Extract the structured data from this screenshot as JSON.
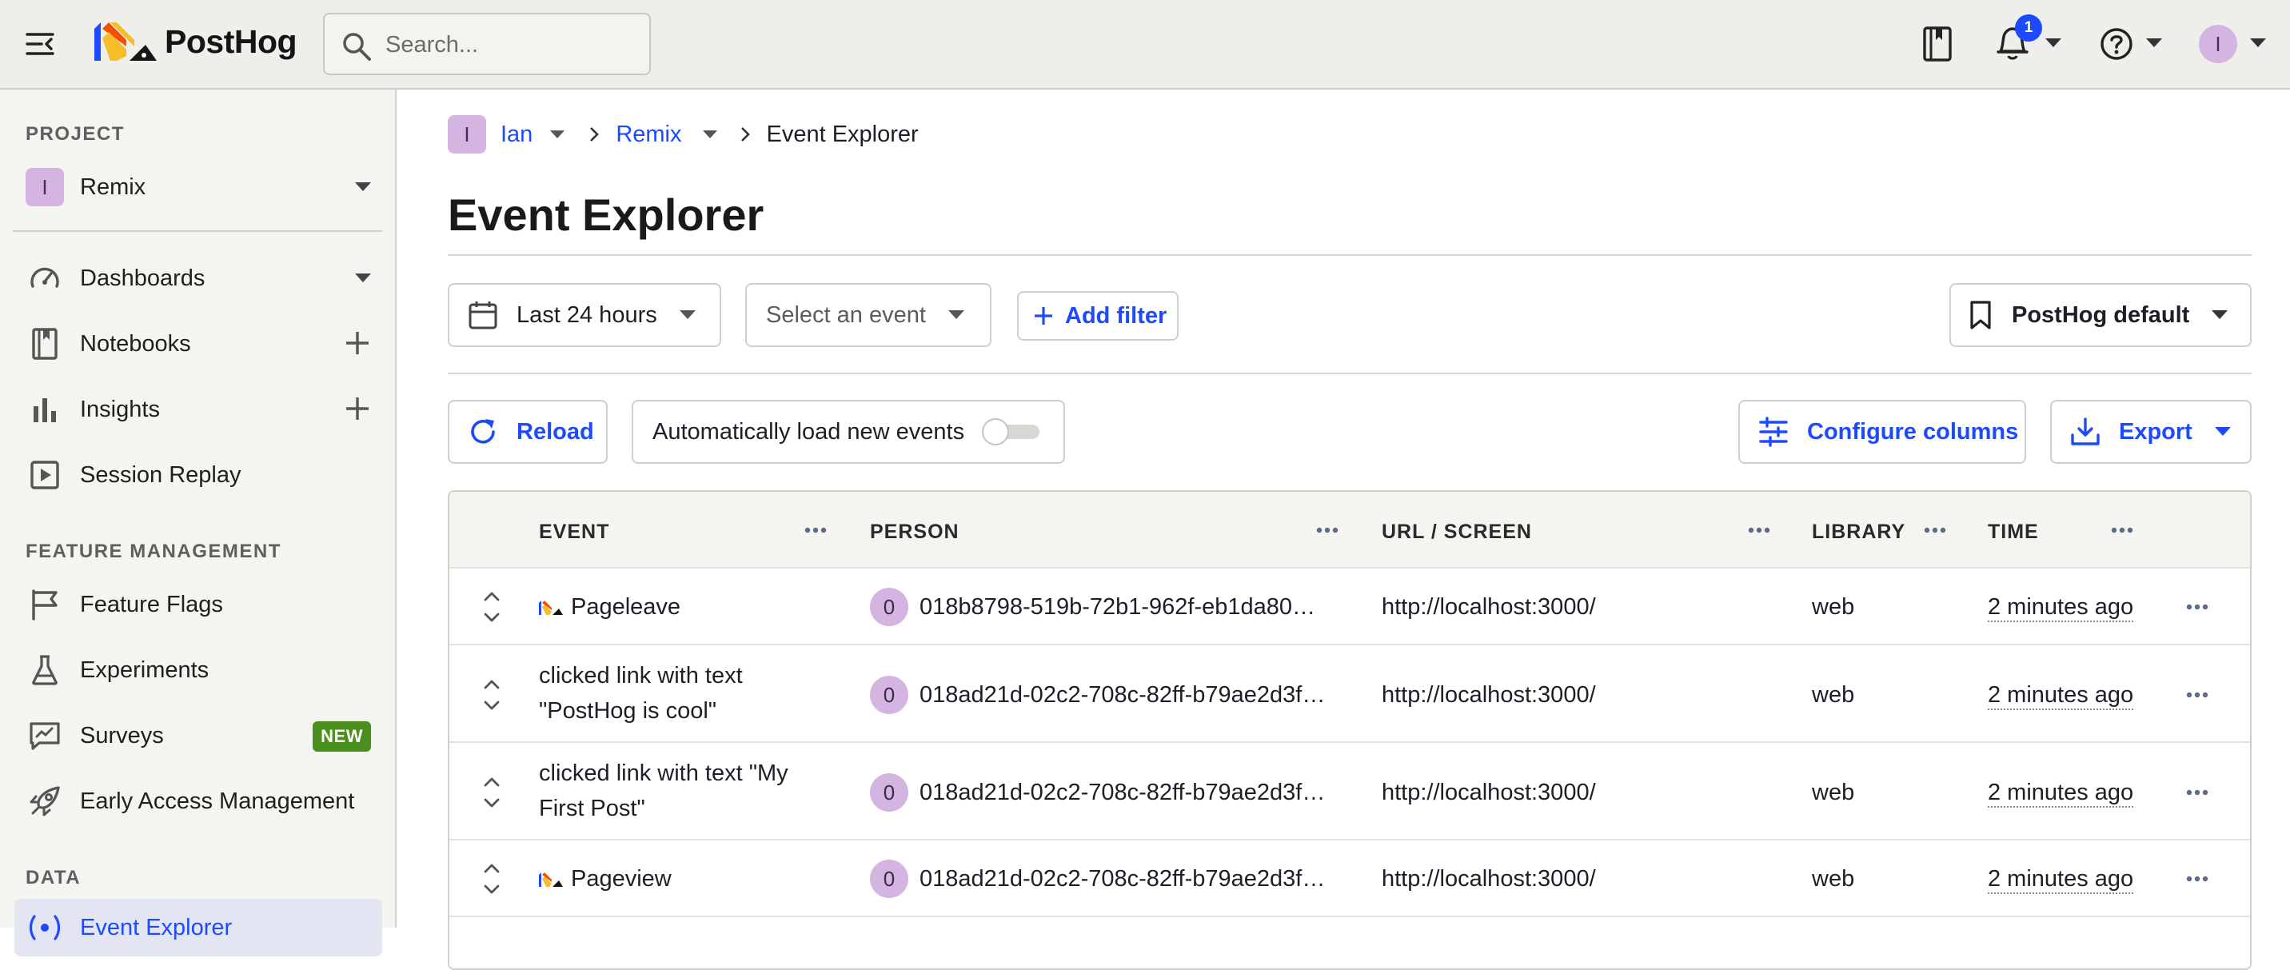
{
  "topbar": {
    "brand": "PostHog",
    "search_placeholder": "Search...",
    "notifications_count": "1",
    "user_initial": "I"
  },
  "sidebar": {
    "project_heading": "PROJECT",
    "project_initial": "I",
    "project_name": "Remix",
    "nav_items": [
      {
        "label": "Dashboards",
        "icon": "dashboard-icon"
      },
      {
        "label": "Notebooks",
        "icon": "notebook-icon"
      },
      {
        "label": "Insights",
        "icon": "insights-icon"
      },
      {
        "label": "Session Replay",
        "icon": "session-replay-icon"
      }
    ],
    "feature_heading": "FEATURE MANAGEMENT",
    "feature_items": [
      {
        "label": "Feature Flags",
        "icon": "flag-icon"
      },
      {
        "label": "Experiments",
        "icon": "flask-icon"
      },
      {
        "label": "Surveys",
        "icon": "survey-icon",
        "badge": "NEW"
      },
      {
        "label": "Early Access Management",
        "icon": "rocket-icon"
      }
    ],
    "data_heading": "DATA",
    "data_items": [
      {
        "label": "Event Explorer",
        "icon": "event-explorer-icon"
      }
    ]
  },
  "breadcrumb": {
    "org_initial": "I",
    "org": "Ian",
    "project": "Remix",
    "page": "Event Explorer"
  },
  "page": {
    "title": "Event Explorer"
  },
  "filters": {
    "date_range": "Last 24 hours",
    "event_placeholder": "Select an event",
    "add_filter": "Add filter",
    "columns_preset": "PostHog default"
  },
  "toolbar": {
    "reload": "Reload",
    "auto_load": "Automatically load new events",
    "auto_load_on": false,
    "configure_columns": "Configure columns",
    "export": "Export"
  },
  "table": {
    "columns": [
      "EVENT",
      "PERSON",
      "URL / SCREEN",
      "LIBRARY",
      "TIME"
    ],
    "rows": [
      {
        "event_line1": "Pageleave",
        "event_line2": "",
        "has_logo": true,
        "person_initial": "0",
        "person": "018b8798-519b-72b1-962f-eb1da80…",
        "url": "http://localhost:3000/",
        "library": "web",
        "time": "2 minutes ago"
      },
      {
        "event_line1": "clicked link with text",
        "event_line2": "\"PostHog is cool\"",
        "has_logo": false,
        "person_initial": "0",
        "person": "018ad21d-02c2-708c-82ff-b79ae2d3f…",
        "url": "http://localhost:3000/",
        "library": "web",
        "time": "2 minutes ago"
      },
      {
        "event_line1": "clicked link with text \"My",
        "event_line2": "First Post\"",
        "has_logo": false,
        "person_initial": "0",
        "person": "018ad21d-02c2-708c-82ff-b79ae2d3f…",
        "url": "http://localhost:3000/",
        "library": "web",
        "time": "2 minutes ago"
      },
      {
        "event_line1": "Pageview",
        "event_line2": "",
        "has_logo": true,
        "person_initial": "0",
        "person": "018ad21d-02c2-708c-82ff-b79ae2d3f…",
        "url": "http://localhost:3000/",
        "library": "web",
        "time": "2 minutes ago"
      }
    ]
  },
  "colors": {
    "accent": "#1d4aff",
    "avatar": "#d4b5e2",
    "new_badge": "#4b8f1f",
    "topbar_bg": "#eeeeea",
    "sidebar_bg": "#f4f4f0"
  }
}
